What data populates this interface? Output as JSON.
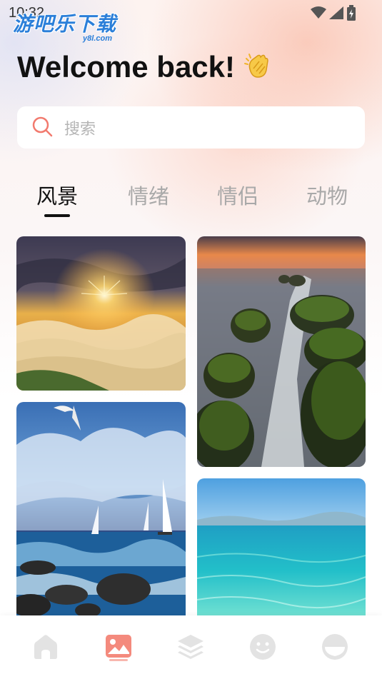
{
  "status_bar": {
    "time": "10:32"
  },
  "watermark": {
    "main": "游吧乐下载",
    "sub": "y8l.com"
  },
  "header": {
    "welcome": "Welcome back!",
    "emoji": "👏"
  },
  "search": {
    "placeholder": "搜索"
  },
  "tabs": [
    {
      "label": "风景",
      "active": true
    },
    {
      "label": "情绪",
      "active": false
    },
    {
      "label": "情侣",
      "active": false
    },
    {
      "label": "动物",
      "active": false
    }
  ],
  "gallery": [
    {
      "name": "sunset-over-clouds-image"
    },
    {
      "name": "mossy-rocks-waterfall-image"
    },
    {
      "name": "sailboats-sea-image"
    },
    {
      "name": "turquoise-sea-image"
    }
  ],
  "bottom_nav": [
    {
      "icon": "home-icon",
      "active": false
    },
    {
      "icon": "image-icon",
      "active": true
    },
    {
      "icon": "layers-icon",
      "active": false
    },
    {
      "icon": "smiley-icon",
      "active": false
    },
    {
      "icon": "face-icon",
      "active": false
    }
  ],
  "colors": {
    "accent": "#f27a6e",
    "inactive_icon": "#e3e3e3",
    "tab_inactive": "#a9a9a9",
    "watermark": "#2b7fd9"
  }
}
